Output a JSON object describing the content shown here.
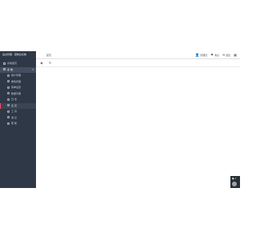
{
  "app": {
    "brand_title": "后台管理 · 控制台系统"
  },
  "sidebar": {
    "items": [
      {
        "label": "系统首页",
        "level": "top"
      },
      {
        "label": "系 统",
        "level": "top",
        "expanded": true
      },
      {
        "label": "用户管理",
        "level": "sub"
      },
      {
        "label": "角色管理",
        "level": "sub"
      },
      {
        "label": "菜单设置",
        "level": "sub"
      },
      {
        "label": "数据字典",
        "level": "sub"
      },
      {
        "label": "日 志",
        "level": "sub"
      },
      {
        "label": "监 控",
        "level": "sub",
        "active": true
      },
      {
        "label": "工 具",
        "level": "sub"
      },
      {
        "label": "消 息",
        "level": "sub"
      },
      {
        "label": "帮 助",
        "level": "sub"
      }
    ]
  },
  "header": {
    "tab_label": "首页",
    "actions": [
      {
        "icon": "user-icon",
        "glyph": "👤",
        "label": "管理员"
      },
      {
        "icon": "flag-icon",
        "glyph": "⚑",
        "label": "消息"
      },
      {
        "icon": "logout-icon",
        "glyph": "⟲",
        "label": "退出"
      },
      {
        "icon": "menu-icon",
        "glyph": "▦",
        "label": ""
      }
    ]
  },
  "toolbar": {
    "back_glyph": "◀",
    "refresh_glyph": "↻"
  },
  "widget": {
    "label": "▣ ♪"
  },
  "colors": {
    "sidebar_bg": "#2f3846",
    "active_indicator": "#ff4d6d"
  }
}
